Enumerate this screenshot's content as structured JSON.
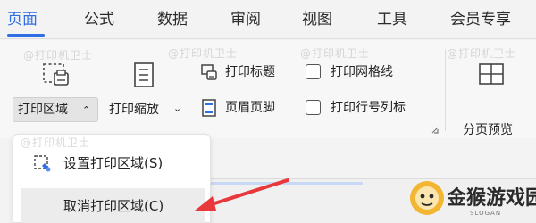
{
  "menu": {
    "tabs": [
      {
        "label": "页面",
        "active": true
      },
      {
        "label": "公式"
      },
      {
        "label": "数据"
      },
      {
        "label": "审阅"
      },
      {
        "label": "视图"
      },
      {
        "label": "工具"
      },
      {
        "label": "会员专享"
      }
    ]
  },
  "ribbon": {
    "print_area": {
      "label": "打印区域",
      "arrow": "⌃"
    },
    "print_scale": {
      "label": "打印缩放",
      "arrow": "⌄"
    },
    "print_title": {
      "label": "打印标题"
    },
    "header_footer": {
      "label": "页眉页脚"
    },
    "print_gridlines": {
      "label": "打印网格线",
      "checked": false
    },
    "print_row_col_headers": {
      "label": "打印行号列标",
      "checked": false
    },
    "page_break_preview": {
      "label": "分页预览"
    }
  },
  "dropdown": {
    "items": [
      {
        "label": "设置打印区域(S)"
      },
      {
        "label": "取消打印区域(C)",
        "highlighted": true
      }
    ]
  },
  "watermark": {
    "text": "@打印机卫士"
  },
  "brand": {
    "name": "金猴游戏园",
    "sub": "SLOGAN"
  },
  "colors": {
    "accent": "#2f6ee5",
    "annotation_arrow": "#e8383b"
  }
}
